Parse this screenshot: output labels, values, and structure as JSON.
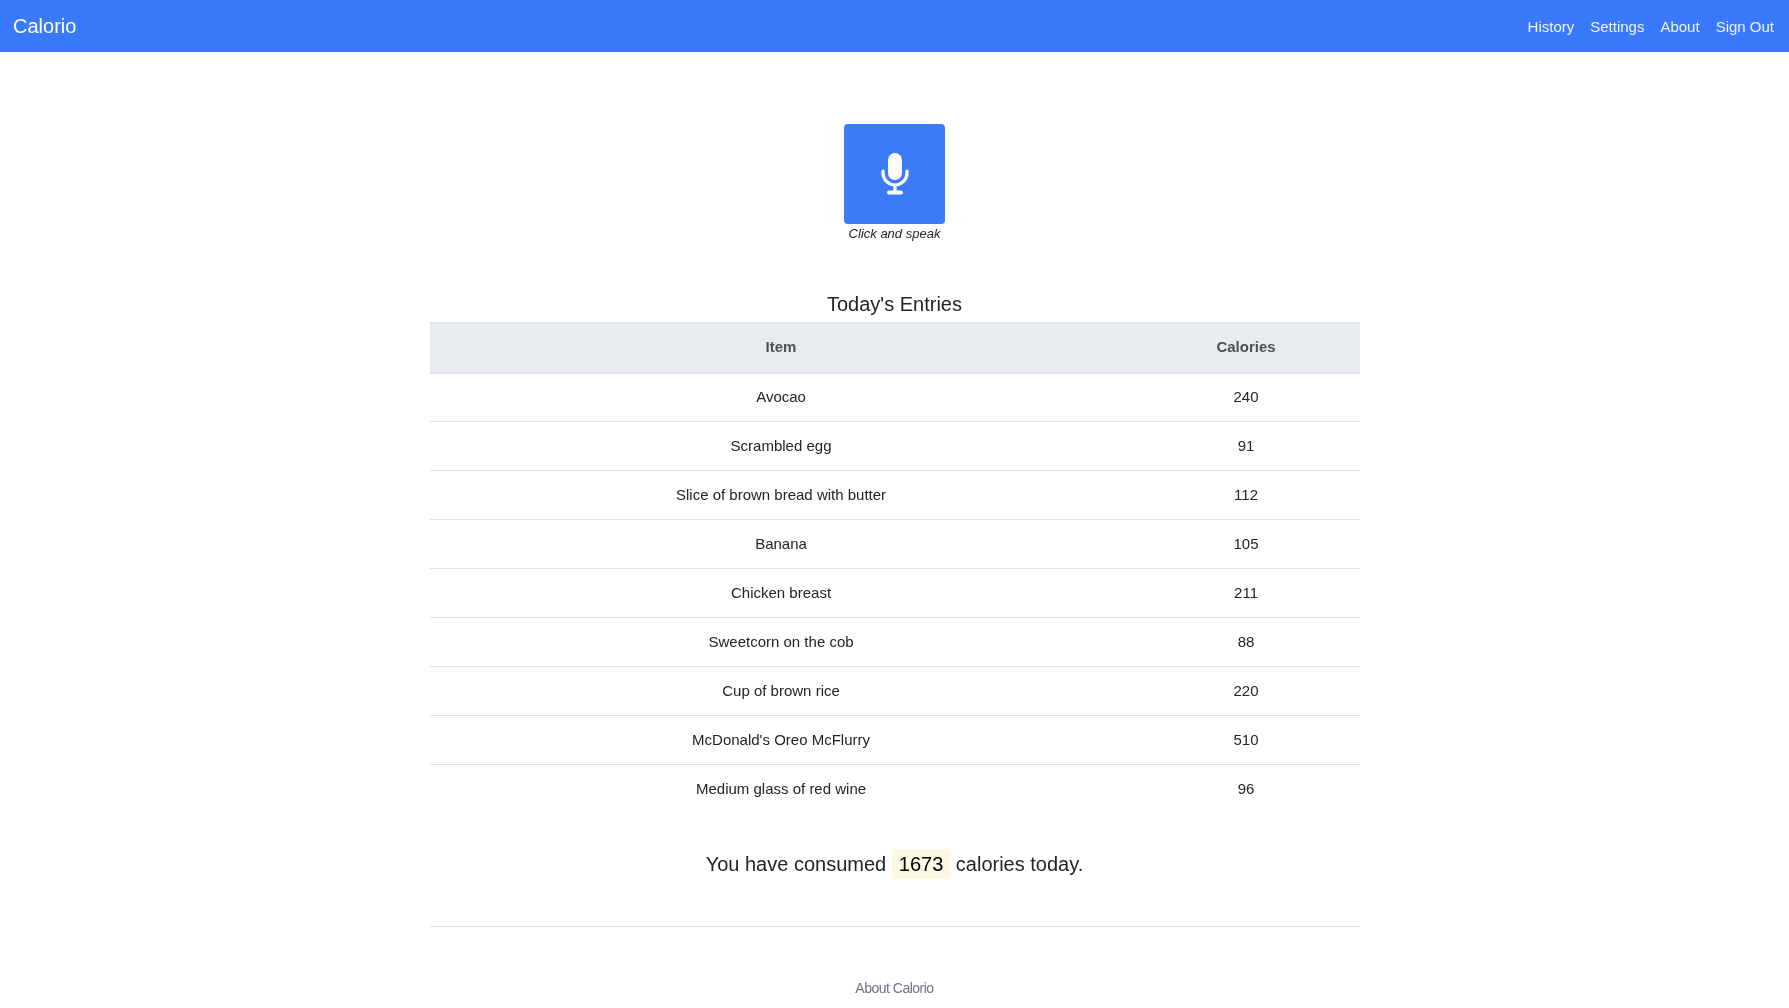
{
  "navbar": {
    "brand": "Calorio",
    "links": [
      "History",
      "Settings",
      "About",
      "Sign Out"
    ]
  },
  "voice_button": {
    "caption": "Click and speak"
  },
  "entries": {
    "title": "Today's Entries",
    "columns": [
      "Item",
      "Calories"
    ],
    "rows": [
      {
        "item": "Avocao",
        "calories": "240"
      },
      {
        "item": "Scrambled egg",
        "calories": "91"
      },
      {
        "item": "Slice of brown bread with butter",
        "calories": "112"
      },
      {
        "item": "Banana",
        "calories": "105"
      },
      {
        "item": "Chicken breast",
        "calories": "211"
      },
      {
        "item": "Sweetcorn on the cob",
        "calories": "88"
      },
      {
        "item": "Cup of brown rice",
        "calories": "220"
      },
      {
        "item": "McDonald's Oreo McFlurry",
        "calories": "510"
      },
      {
        "item": "Medium glass of red wine",
        "calories": "96"
      }
    ]
  },
  "summary": {
    "text_before": "You have consumed",
    "total": "1673",
    "text_after": "calories today."
  },
  "footer": {
    "link": "About Calorio"
  }
}
